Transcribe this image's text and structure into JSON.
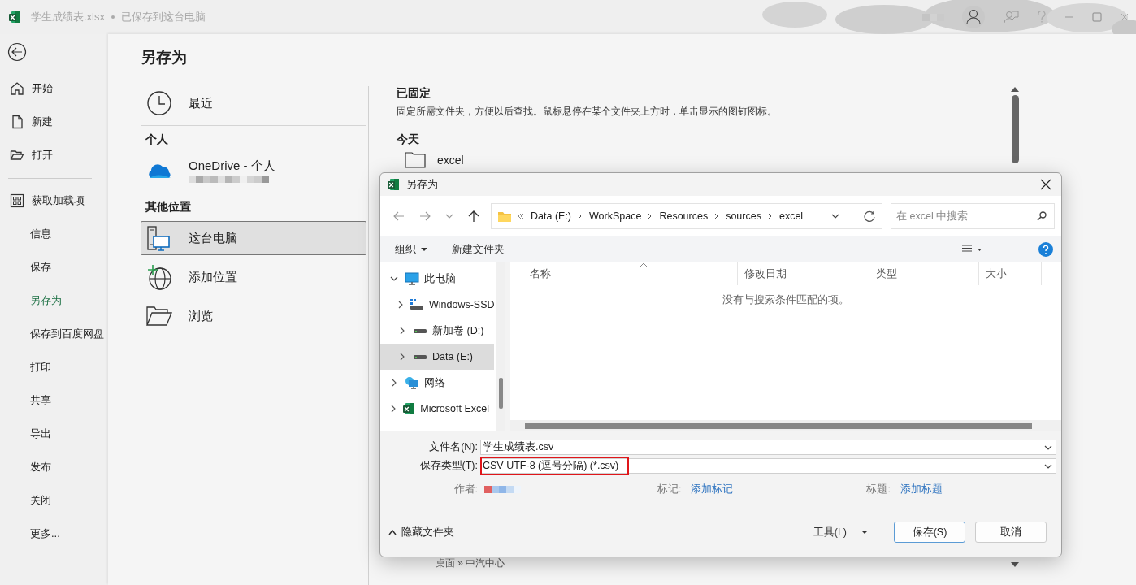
{
  "app_window": {
    "file_name": "学生成绩表.xlsx",
    "save_status": "已保存到这台电脑"
  },
  "nav": {
    "top": [
      {
        "label": "开始",
        "selected": false
      },
      {
        "label": "新建",
        "selected": false
      },
      {
        "label": "打开",
        "selected": false
      },
      {
        "label": "获取加载项",
        "selected": false
      }
    ],
    "bottom": [
      {
        "label": "信息",
        "selected": false
      },
      {
        "label": "保存",
        "selected": false
      },
      {
        "label": "另存为",
        "selected": true
      },
      {
        "label": "保存到百度网盘",
        "selected": false
      },
      {
        "label": "打印",
        "selected": false
      },
      {
        "label": "共享",
        "selected": false
      },
      {
        "label": "导出",
        "selected": false
      },
      {
        "label": "发布",
        "selected": false
      },
      {
        "label": "关闭",
        "selected": false
      },
      {
        "label": "更多...",
        "selected": false
      }
    ]
  },
  "page_title": "另存为",
  "locations": [
    {
      "items": [
        {
          "kind": "recent",
          "label": "最近",
          "selected": false
        }
      ]
    },
    {
      "heading": "个人",
      "items": [
        {
          "kind": "cloud",
          "label": "OneDrive - 个人",
          "selected": false
        }
      ]
    },
    {
      "heading": "其他位置",
      "items": [
        {
          "kind": "pc",
          "label": "这台电脑",
          "selected": true
        },
        {
          "kind": "add",
          "label": "添加位置",
          "selected": false
        },
        {
          "kind": "browse",
          "label": "浏览",
          "selected": false
        }
      ]
    }
  ],
  "pinned": {
    "heading": "已固定",
    "hint": "固定所需文件夹，方便以后查找。鼠标悬停在某个文件夹上方时，单击显示的图钉图标。",
    "today_heading": "今天",
    "folder_name": "excel",
    "folder_path": "桌面 » 中汽中心"
  },
  "dialog": {
    "title": "另存为",
    "breadcrumb": [
      "Data (E:)",
      "WorkSpace",
      "Resources",
      "sources",
      "excel"
    ],
    "search_placeholder": "在 excel 中搜索",
    "organize": "组织",
    "new_folder": "新建文件夹",
    "tree": [
      {
        "kind": "pc",
        "label": "此电脑",
        "expanded": true,
        "selected": false,
        "children": [
          {
            "kind": "os_drive",
            "label": "Windows-SSD",
            "expanded": false,
            "selected": false
          },
          {
            "kind": "drive",
            "label": "新加卷 (D:)",
            "expanded": false,
            "selected": false
          },
          {
            "kind": "drive",
            "label": "Data (E:)",
            "expanded": false,
            "selected": true
          }
        ]
      },
      {
        "kind": "network",
        "label": "网络",
        "expanded": false,
        "selected": false
      },
      {
        "kind": "excel",
        "label": "Microsoft Excel",
        "expanded": false,
        "selected": false
      }
    ],
    "columns": [
      "名称",
      "修改日期",
      "类型",
      "大小"
    ],
    "empty_message": "没有与搜索条件匹配的项。",
    "file_name_label": "文件名(N):",
    "file_name": "学生成绩表.csv",
    "file_type_label": "保存类型(T):",
    "file_type": "CSV UTF-8 (逗号分隔) (*.csv)",
    "file_type_highlighted": true,
    "author_label": "作者:",
    "tags_label": "标记:",
    "tags_link": "添加标记",
    "title_label": "标题:",
    "title_link": "添加标题",
    "hide_folders": "隐藏文件夹",
    "tools": "工具(L)",
    "save": "保存(S)",
    "cancel": "取消"
  }
}
